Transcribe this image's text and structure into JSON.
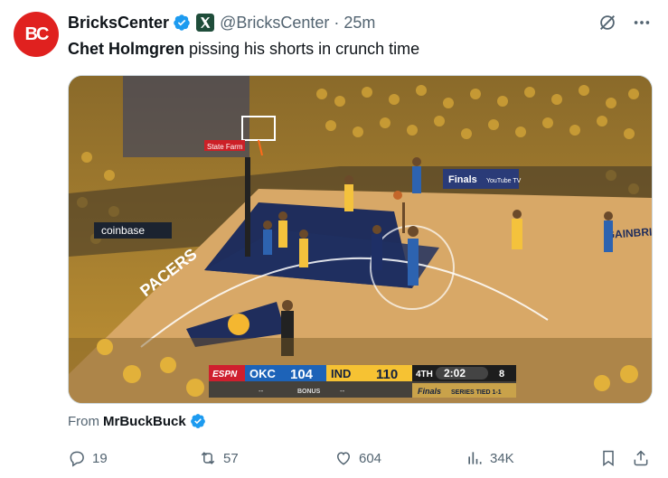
{
  "tweet": {
    "display_name": "BricksCenter",
    "handle": "@BricksCenter",
    "separator": "·",
    "time": "25m",
    "text_bold": "Chet Holmgren",
    "text_rest": " pissing his shorts in crunch time",
    "avatar_text": "BC"
  },
  "media": {
    "scoreboard": {
      "network": "ESPN",
      "team1": "OKC",
      "score1": "104",
      "team2": "IND",
      "score2": "110",
      "quarter": "4TH",
      "clock": "2:02",
      "shot_clock": "8",
      "bonus": "BONUS",
      "dash1": "--",
      "dash2": "--",
      "finals": "Finals",
      "series": "SERIES TIED 1-1"
    },
    "signage": {
      "coinbase": "coinbase",
      "statefarm": "State Farm",
      "finals_board": "Finals",
      "youtube": "YouTube TV",
      "floor_pacers": "PACERS",
      "floor_right": "GAINBRIDGE FIELDHOUSE"
    }
  },
  "attribution": {
    "prefix": "From",
    "source": "MrBuckBuck"
  },
  "actions": {
    "replies": "19",
    "reposts": "57",
    "likes": "604",
    "views": "34K"
  },
  "colors": {
    "accent_blue": "#1d9bf0",
    "avatar_red": "#e0211f",
    "text_gray": "#536471"
  }
}
